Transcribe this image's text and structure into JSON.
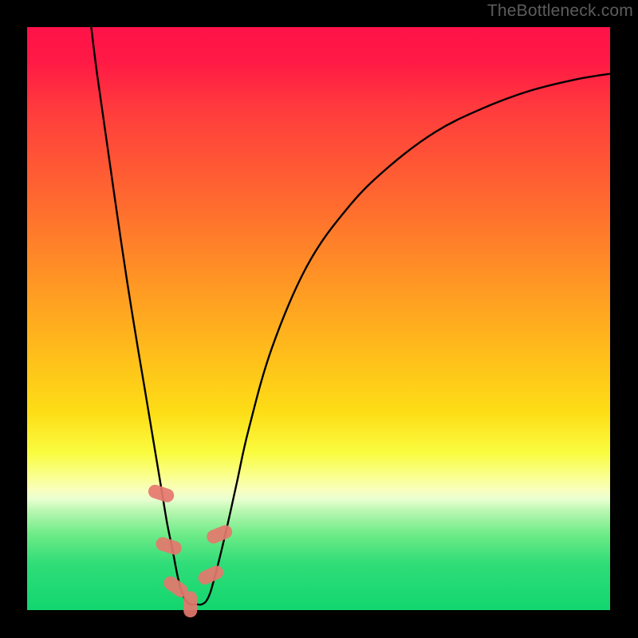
{
  "watermark": "TheBottleneck.com",
  "chart_data": {
    "type": "line",
    "title": "",
    "xlabel": "",
    "ylabel": "",
    "xlim": [
      0,
      100
    ],
    "ylim": [
      0,
      100
    ],
    "series": [
      {
        "name": "curve",
        "x": [
          11,
          12,
          14,
          16,
          18,
          20,
          22,
          23,
          24,
          25,
          26,
          27,
          28,
          29,
          30,
          31,
          32,
          34,
          36,
          38,
          42,
          48,
          55,
          62,
          70,
          78,
          86,
          94,
          100
        ],
        "y": [
          100,
          92,
          78,
          64,
          51,
          39,
          27,
          21,
          15,
          10,
          5,
          2,
          1,
          1,
          1,
          2,
          5,
          13,
          22,
          31,
          45,
          59,
          69,
          76,
          82,
          86,
          89,
          91,
          92
        ]
      }
    ],
    "markers": [
      {
        "x": 23.0,
        "y": 20,
        "rot": -72
      },
      {
        "x": 24.3,
        "y": 11,
        "rot": -72
      },
      {
        "x": 25.5,
        "y": 4,
        "rot": -55
      },
      {
        "x": 28.0,
        "y": 1,
        "rot": 0
      },
      {
        "x": 31.5,
        "y": 6,
        "rot": 65
      },
      {
        "x": 33.0,
        "y": 13,
        "rot": 68
      }
    ],
    "marker_color": "#e5776e"
  }
}
